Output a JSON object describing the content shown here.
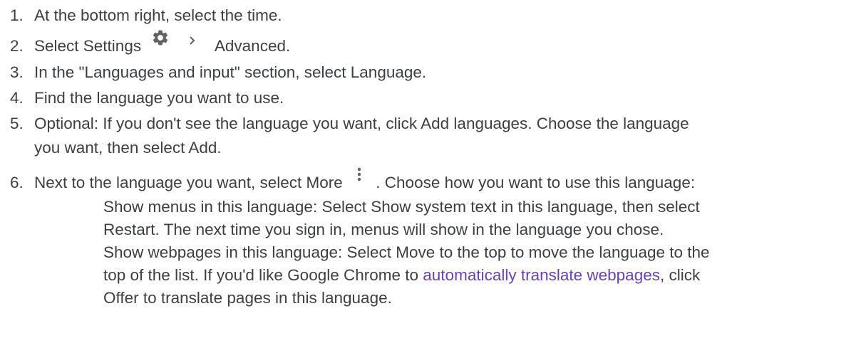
{
  "steps": [
    {
      "number": "1.",
      "text": "At the bottom right, select the time."
    },
    {
      "number": "2.",
      "text_before": "Select Settings",
      "text_after": "Advanced."
    },
    {
      "number": "3.",
      "text": "In the \"Languages and input\" section, select Language."
    },
    {
      "number": "4.",
      "text": "Find the language you want to use."
    },
    {
      "number": "5.",
      "line1": "Optional: If you don't see the language you want, click Add languages. Choose the language",
      "line2": "you want, then select Add."
    },
    {
      "number": "6.",
      "text_before": "Next to the language you want, select More",
      "text_after": ". Choose how you want to use this language:"
    }
  ],
  "substeps": {
    "menus_line1": "Show menus in this language: Select Show system text in this language, then select",
    "menus_line2": "Restart. The next time you sign in, menus will show in the language you chose.",
    "webpages_line1": "Show webpages in this language: Select Move to the top to move the language to the",
    "webpages_line2_before": "top of the list. If you'd like Google Chrome to ",
    "webpages_link": "automatically translate webpages",
    "webpages_line2_after": ", click",
    "webpages_line3": "Offer to translate pages in this language."
  },
  "icons": {
    "settings": "gear-icon",
    "chevron": "chevron-right-icon",
    "more": "more-vert-icon"
  },
  "colors": {
    "text": "#3c4043",
    "icon": "#616161",
    "link": "#6a3fbf"
  }
}
